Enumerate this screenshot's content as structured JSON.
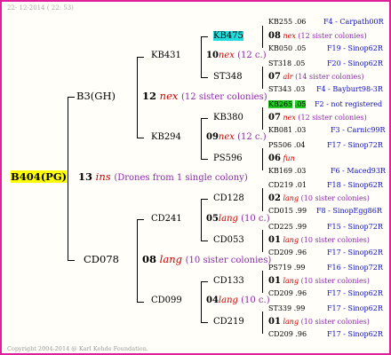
{
  "header": "22- 12-2014 ( 22: 53)",
  "footer": "Copyright 2004-2014 @ Karl Kehde Foundation.",
  "root": {
    "label": "B404(PG)",
    "num": "13",
    "mate": "ins",
    "note": "(Drones from 1 single colony)"
  },
  "gen2": [
    {
      "label": "B3(GH)",
      "num": "12",
      "mate": "nex",
      "sis": "(12 sister colonies)"
    },
    {
      "label": "CD078",
      "num": "08",
      "mate": "lang",
      "sis": "(10 sister colonies)"
    }
  ],
  "gen3": [
    {
      "label": "KB431",
      "num": "10",
      "mate": "nex",
      "sis": "(12 c.)"
    },
    {
      "label": "KB294",
      "num": "09",
      "mate": "nex",
      "sis": "(12 c.)"
    },
    {
      "label": "CD241",
      "num": "05",
      "mate": "lang",
      "sis": "(10 c.)"
    },
    {
      "label": "CD099",
      "num": "04",
      "mate": "lang",
      "sis": "(10 c.)"
    }
  ],
  "gen4": [
    {
      "label": "KB475",
      "num": "08",
      "mate": "nex",
      "sis": "(12 sister colonies)"
    },
    {
      "label": "ST348",
      "num": "07",
      "mate": "alr",
      "sis": "(14 sister colonies)"
    },
    {
      "label": "KB380",
      "num": "07",
      "mate": "nex",
      "sis": "(12 sister colonies)"
    },
    {
      "label": "PS596",
      "num": "06",
      "mate": "fun",
      "sis": ""
    },
    {
      "label": "CD128",
      "num": "02",
      "mate": "lang",
      "sis": "(10 sister colonies)"
    },
    {
      "label": "CD053",
      "num": "01",
      "mate": "lang",
      "sis": "(10 sister colonies)"
    },
    {
      "label": "CD133",
      "num": "01",
      "mate": "lang",
      "sis": "(10 sister colonies)"
    },
    {
      "label": "CD219",
      "num": "01",
      "mate": "lang",
      "sis": "(10 sister colonies)"
    }
  ],
  "gen5": [
    {
      "id": "KB255",
      "yr": ".06",
      "info": "F4 - Carpath00R"
    },
    {
      "id": "KB050",
      "yr": ".05",
      "info": "F19 - Sinop62R"
    },
    {
      "id": "ST318",
      "yr": ".05",
      "info": "F20 - Sinop62R"
    },
    {
      "id": "ST343",
      "yr": ".03",
      "info": "F4 - Bayburt98-3R"
    },
    {
      "id": "KB265",
      "yr": ".05",
      "info": "F2 - not registered"
    },
    {
      "id": "KB081",
      "yr": ".03",
      "info": "F3 - Carnic99R"
    },
    {
      "id": "PS506",
      "yr": ".04",
      "info": "F17 - Sinop72R"
    },
    {
      "id": "KB169",
      "yr": ".03",
      "info": "F6 - Maced93R"
    },
    {
      "id": "CD219",
      "yr": ".01",
      "info": "F18 - Sinop62R"
    },
    {
      "id": "CD015",
      "yr": ".99",
      "info": "F8 - SinopEgg86R"
    },
    {
      "id": "CD225",
      "yr": ".99",
      "info": "F15 - Sinop72R"
    },
    {
      "id": "CD209",
      "yr": ".96",
      "info": "F17 - Sinop62R"
    },
    {
      "id": "PS719",
      "yr": ".99",
      "info": "F16 - Sinop72R"
    },
    {
      "id": "CD209",
      "yr": ".96",
      "info": "F17 - Sinop62R"
    },
    {
      "id": "ST339",
      "yr": ".99",
      "info": "F17 - Sinop62R"
    },
    {
      "id": "CD209",
      "yr": ".96",
      "info": "F17 - Sinop62R"
    }
  ]
}
